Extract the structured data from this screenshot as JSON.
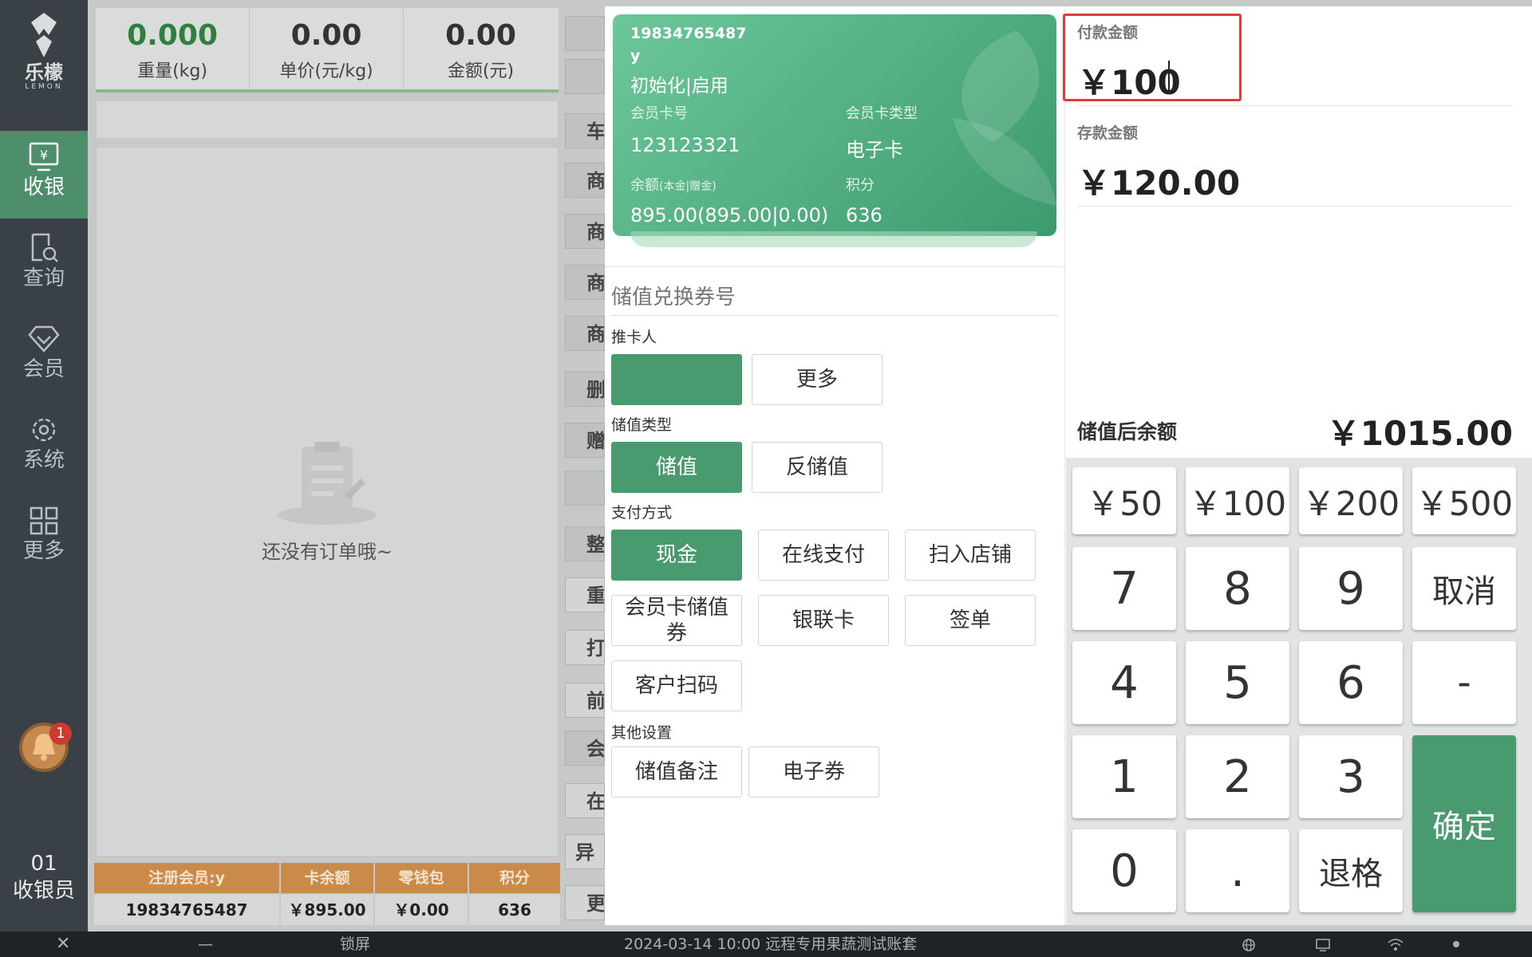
{
  "sidebar": {
    "logo_cn": "乐檬",
    "logo_en": "LEMON",
    "nav": [
      {
        "label": "收银",
        "icon": "cashier-icon",
        "active": true
      },
      {
        "label": "查询",
        "icon": "search-doc-icon",
        "active": false
      },
      {
        "label": "会员",
        "icon": "diamond-icon",
        "active": false
      },
      {
        "label": "系统",
        "icon": "gear-icon",
        "active": false
      },
      {
        "label": "更多",
        "icon": "grid-icon",
        "active": false
      }
    ],
    "notification_count": "1",
    "cashier_id": "01",
    "cashier_label": "收银员"
  },
  "scale": {
    "weight_value": "0.000",
    "weight_label": "重量(kg)",
    "price_value": "0.00",
    "price_label": "单价(元/kg)",
    "amount_value": "0.00",
    "amount_label": "金额(元)"
  },
  "order": {
    "empty_text": "还没有订单哦~"
  },
  "member_table": {
    "headers": [
      "注册会员:y",
      "卡余额",
      "零钱包",
      "积分"
    ],
    "values": [
      "19834765487",
      "￥895.00",
      "￥0.00",
      "636"
    ]
  },
  "side_buttons": [
    "车",
    "商",
    "商",
    "商",
    "商",
    "删",
    "赠",
    "",
    "整",
    "重",
    "打",
    "前",
    "会",
    "在",
    "异常",
    "更"
  ],
  "card": {
    "phone": "19834765487",
    "name": "y",
    "status": "初始化|启用",
    "card_no_label": "会员卡号",
    "card_no": "123123321",
    "card_type_label": "会员卡类型",
    "card_type": "电子卡",
    "balance_label": "余额",
    "balance_sub": "(本金|赠金)",
    "balance": "895.00(895.00|0.00)",
    "points_label": "积分",
    "points": "636"
  },
  "form": {
    "voucher_placeholder": "储值兑换券号",
    "recommender_label": "推卡人",
    "recommender_more": "更多",
    "stored_type_label": "储值类型",
    "stored_types": [
      "储值",
      "反储值"
    ],
    "payment_label": "支付方式",
    "payments": [
      "现金",
      "在线支付",
      "扫入店铺",
      "会员卡储值券",
      "银联卡",
      "签单",
      "客户扫码"
    ],
    "other_label": "其他设置",
    "others": [
      "储值备注",
      "电子券"
    ]
  },
  "payment": {
    "pay_label": "付款金额",
    "pay_value": "￥100",
    "deposit_label": "存款金额",
    "deposit_value": "￥120.00",
    "after_label": "储值后余额",
    "after_value": "￥1015.00"
  },
  "keypad": {
    "quick": [
      "￥50",
      "￥100",
      "￥200",
      "￥500"
    ],
    "digits": [
      "7",
      "8",
      "9",
      "4",
      "5",
      "6",
      "1",
      "2",
      "3",
      "0",
      "."
    ],
    "cancel": "取消",
    "minus": "-",
    "backspace": "退格",
    "confirm": "确定"
  },
  "taskbar": {
    "close": "✕",
    "minimize": "—",
    "lock": "锁屏",
    "info": "2024-03-14 10:00 远程专用果蔬测试账套"
  },
  "colors": {
    "sidebar_bg": "#3a4146",
    "accent_green": "#4a9a6f",
    "member_header": "#c98a4a",
    "highlight": "#e53935"
  }
}
